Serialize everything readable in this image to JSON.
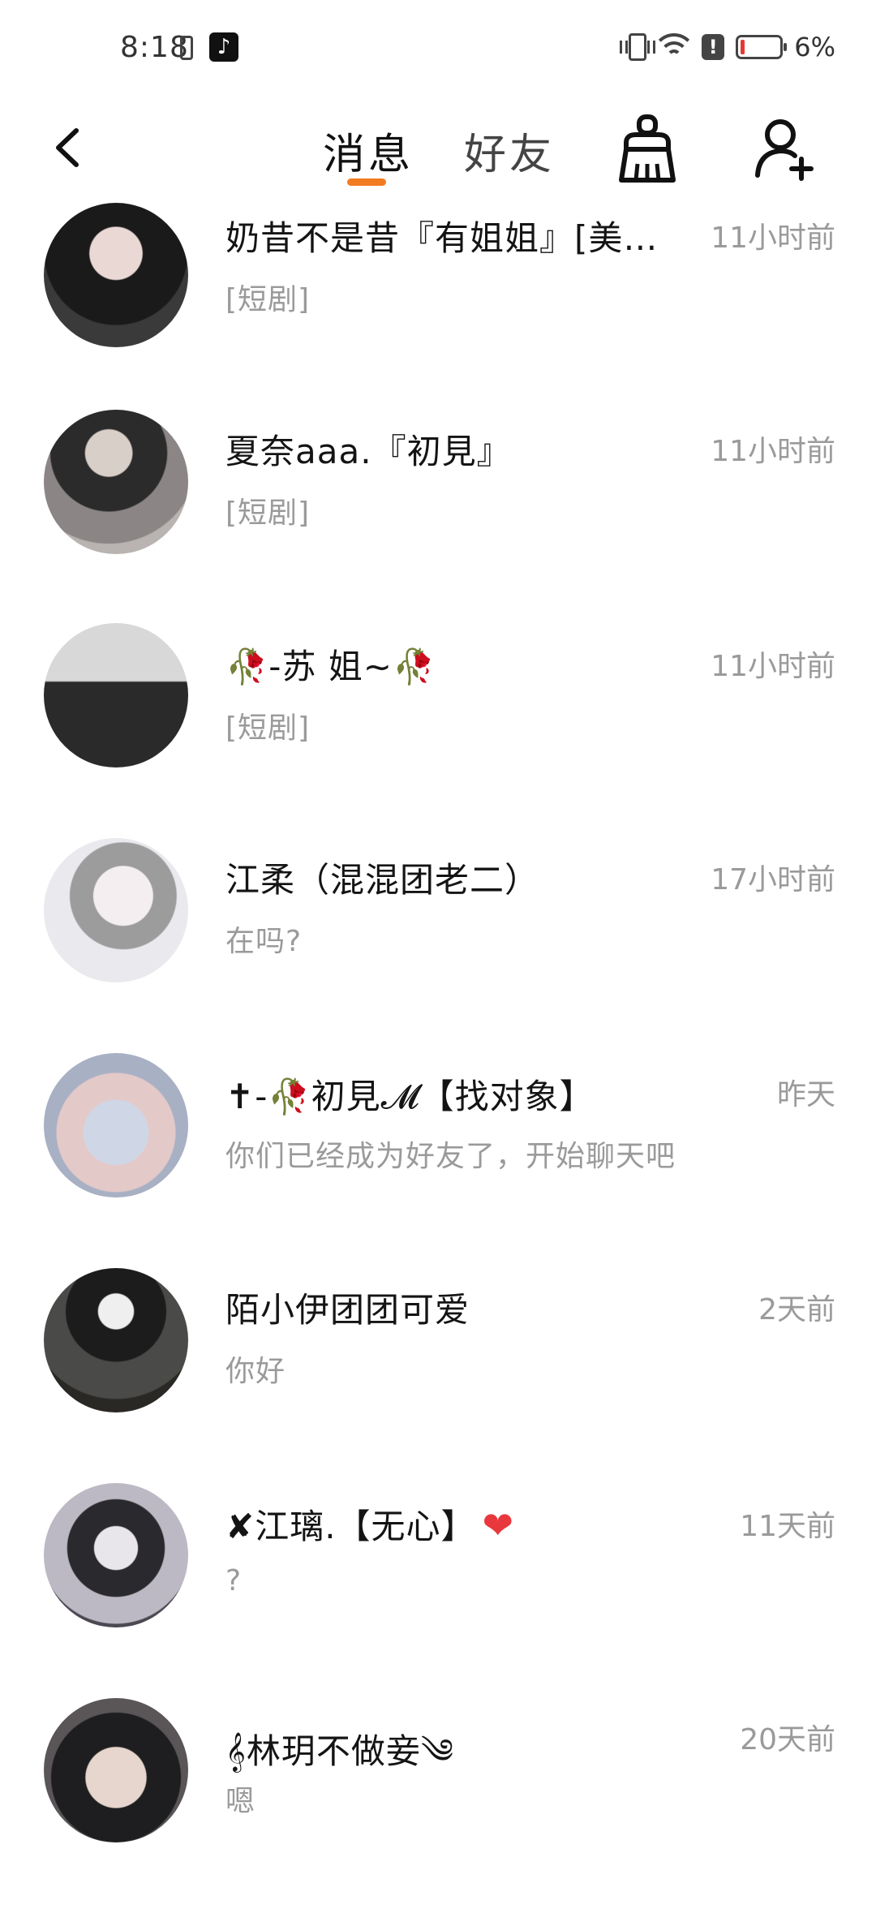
{
  "status_bar": {
    "time": "8:18",
    "tiktok_glyph": "♪",
    "alert_glyph": "!",
    "battery_percent": "6%"
  },
  "nav": {
    "tab_messages": "消息",
    "tab_friends": "好友",
    "active_tab_color": "#f37b21"
  },
  "messages": [
    {
      "name": "奶昔不是昔『有姐姐』[美…",
      "preview": "[短剧]",
      "time": "11小时前",
      "avatar": "avatar-gothic-maid"
    },
    {
      "name": "夏奈aaa.『初見』",
      "preview": "[短剧]",
      "time": "11小时前",
      "avatar": "avatar-dark-hair-girl"
    },
    {
      "name": "🥀-苏 姐~🥀",
      "preview": "[短剧]",
      "time": "11小时前",
      "avatar": "avatar-mirror-selfie"
    },
    {
      "name": "江柔（混混团老二）",
      "preview": "在吗?",
      "time": "17小时前",
      "avatar": "avatar-anime-sketch"
    },
    {
      "name": "✝-🥀初見𝓜【找对象】",
      "preview": "你们已经成为好友了，开始聊天吧",
      "time": "昨天",
      "avatar": "avatar-white-dress"
    },
    {
      "name": "陌小伊团团可爱",
      "preview": "你好",
      "time": "2天前",
      "avatar": "avatar-motorcycle-helmets"
    },
    {
      "name": "✘江璃.【无心】",
      "name_suffix": "❤",
      "preview": "?",
      "time": "11天前",
      "avatar": "avatar-anime-twins"
    },
    {
      "name": "𝄞林玥不做妾༄",
      "preview": "嗯",
      "time": "20天前",
      "avatar": "avatar-selfie-closeup"
    }
  ]
}
